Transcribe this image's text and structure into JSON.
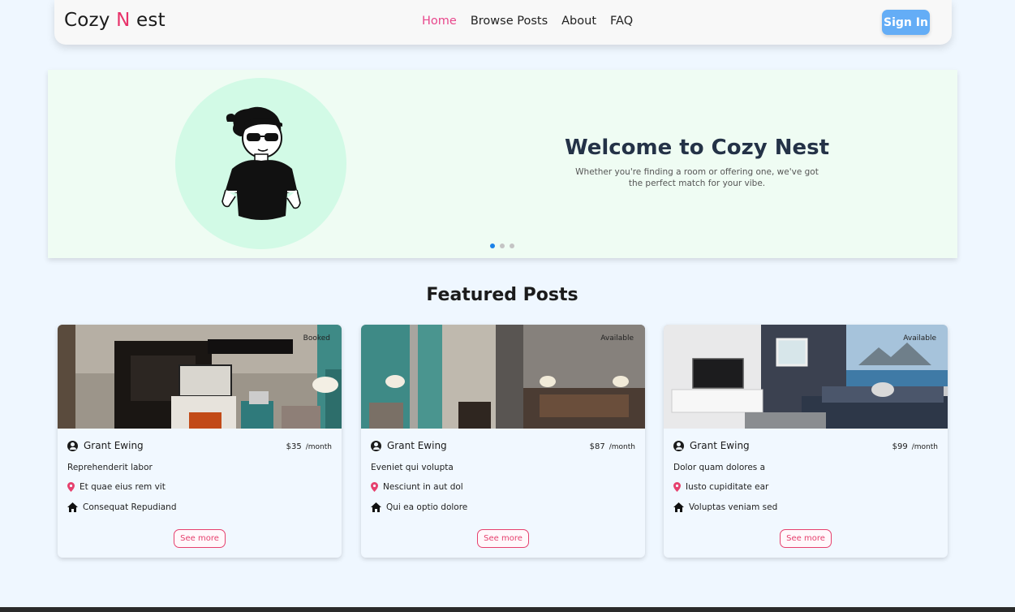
{
  "brand": {
    "part1": "Cozy ",
    "accent": "N",
    "part2": " est"
  },
  "nav": {
    "links": [
      {
        "label": "Home",
        "active": true
      },
      {
        "label": "Browse Posts",
        "active": false
      },
      {
        "label": "About",
        "active": false
      },
      {
        "label": "FAQ",
        "active": false
      }
    ],
    "signin_label": "Sign In"
  },
  "hero": {
    "title": "Welcome to Cozy Nest",
    "subtitle": "Whether you're finding a room or offering one, we've got the perfect match for your vibe.",
    "slides": 3,
    "active_slide": 0
  },
  "featured": {
    "title": "Featured Posts",
    "posts": [
      {
        "status": "Booked",
        "owner": "Grant Ewing",
        "price": "$35",
        "per": "/month",
        "title": "Reprehenderit labor",
        "location": "Et quae eius rem vit",
        "type": "Consequat Repudiand",
        "button": "See more"
      },
      {
        "status": "Available",
        "owner": "Grant Ewing",
        "price": "$87",
        "per": "/month",
        "title": "Eveniet qui volupta",
        "location": "Nesciunt in aut dol",
        "type": "Qui ea optio dolore",
        "button": "See more"
      },
      {
        "status": "Available",
        "owner": "Grant Ewing",
        "price": "$99",
        "per": "/month",
        "title": "Dolor quam dolores a",
        "location": "Iusto cupiditate ear",
        "type": "Voluptas veniam sed",
        "button": "See more"
      }
    ]
  },
  "colors": {
    "accent_pink": "#e8336a",
    "signin_blue": "#64adf6",
    "hero_bg": "#effcf3",
    "avatar_circle": "#d2fae6",
    "page_bg": "#eff7ff"
  }
}
